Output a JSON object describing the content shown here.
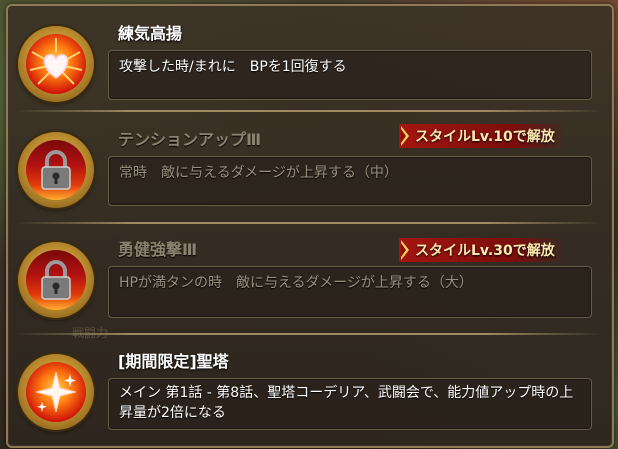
{
  "skills": [
    {
      "title": "練気高揚",
      "description": "攻撃した時/まれに　BPを1回復する",
      "locked": false,
      "icon": "heart-burst-icon",
      "unlock_label": ""
    },
    {
      "title": "テンションアップⅢ",
      "description": "常時　敵に与えるダメージが上昇する（中）",
      "locked": true,
      "icon": "padlock-icon",
      "unlock_label": "スタイルLv.10で解放"
    },
    {
      "title": "勇健強撃Ⅲ",
      "description": "HPが満タンの時　敵に与えるダメージが上昇する（大）",
      "locked": true,
      "icon": "padlock-icon",
      "unlock_label": "スタイルLv.30で解放"
    },
    {
      "title": "[期間限定]聖塔",
      "description": "メイン 第1話 - 第8話、聖塔コーデリア、武闘会で、能力値アップ時の上昇量が2倍になる",
      "locked": false,
      "icon": "sparkle-icon",
      "unlock_label": ""
    }
  ],
  "background_text": "戦闘力",
  "colors": {
    "badge": "#a8140f",
    "medal_gold": "#d4a640",
    "locked_text": "#8c8270"
  }
}
